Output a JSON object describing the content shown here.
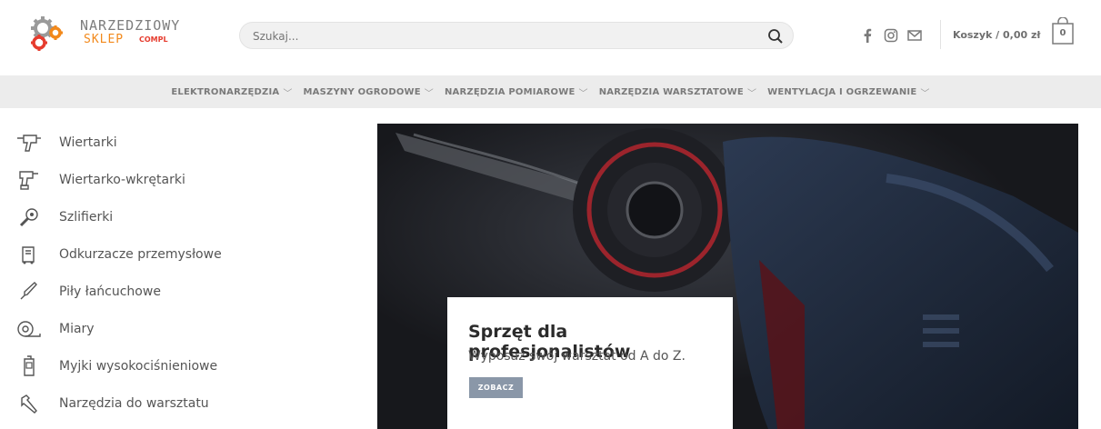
{
  "logo": {
    "line1": "NARZEDZIOWY",
    "line2": "SKLEP",
    "line3": "COMPL"
  },
  "search": {
    "placeholder": "Szukaj..."
  },
  "cart": {
    "label": "Koszyk / 0,00 zł",
    "count": "0"
  },
  "social": [
    "facebook-icon",
    "instagram-icon",
    "envelope-icon"
  ],
  "nav": {
    "items": [
      {
        "label": "ELEKTRONARZĘDZIA"
      },
      {
        "label": "MASZYNY OGRODOWE"
      },
      {
        "label": "NARZĘDZIA POMIAROWE"
      },
      {
        "label": "NARZĘDZIA WARSZTATOWE"
      },
      {
        "label": "WENTYLACJA I OGRZEWANIE"
      }
    ]
  },
  "sidebar": {
    "items": [
      {
        "label": "Wiertarki",
        "icon": "drill-icon"
      },
      {
        "label": "Wiertarko-wkrętarki",
        "icon": "drill-driver-icon"
      },
      {
        "label": "Szlifierki",
        "icon": "grinder-icon"
      },
      {
        "label": "Odkurzacze przemysłowe",
        "icon": "vacuum-icon"
      },
      {
        "label": "Piły łańcuchowe",
        "icon": "chainsaw-icon"
      },
      {
        "label": "Miary",
        "icon": "tape-measure-icon"
      },
      {
        "label": "Myjki wysokociśnieniowe",
        "icon": "pressure-washer-icon"
      },
      {
        "label": "Narzędzia do warsztatu",
        "icon": "hammer-icon"
      }
    ]
  },
  "hero": {
    "title": "Sprzęt dla profesjonalistów",
    "subtitle": "Wyposaż swój warsztat od A do Z.",
    "button": "ZOBACZ"
  },
  "colors": {
    "accent": "#f2891b",
    "logo_red": "#e63c2e",
    "button": "#8a97a8",
    "nav_bg": "#ececec"
  }
}
